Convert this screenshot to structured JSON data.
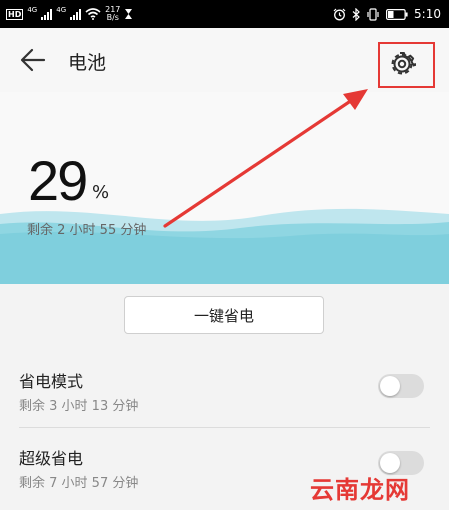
{
  "status_bar": {
    "hd": "HD",
    "net1": "4G",
    "net2": "4G",
    "speed_value": "217",
    "speed_unit": "B/s",
    "time": "5:10"
  },
  "header": {
    "title": "电池"
  },
  "battery": {
    "percent": "29",
    "percent_sign": "%",
    "remaining": "剩余 2 小时 55 分钟"
  },
  "actions": {
    "one_key_label": "一键省电"
  },
  "rows": [
    {
      "title": "省电模式",
      "subtitle": "剩余 3 小时 13 分钟",
      "enabled": false
    },
    {
      "title": "超级省电",
      "subtitle": "剩余 7 小时 57 分钟",
      "enabled": false
    }
  ],
  "watermark": "云南龙网",
  "colors": {
    "accent_red": "#e53935",
    "wave_blue": "#7fcfdd"
  }
}
